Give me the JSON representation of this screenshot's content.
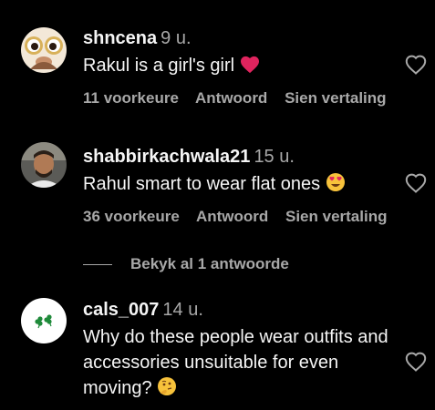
{
  "colors": {
    "background": "#000000",
    "primary_text": "#f5f5f5",
    "secondary_text": "#a8a8a8",
    "emoji_heart": "#e0245e",
    "emoji_yellow": "#f7c23b"
  },
  "comments": [
    {
      "username": "shncena",
      "time": "9 u.",
      "text": "Rakul is a girl's girl",
      "emoji": "red-heart-emoji",
      "likes": "11 voorkeure",
      "reply_label": "Antwoord",
      "translate_label": "Sien vertaling"
    },
    {
      "username": "shabbirkachwala21",
      "time": "15 u.",
      "text": "Rahul smart to wear flat ones",
      "emoji": "heart-eyes-emoji",
      "likes": "36 voorkeure",
      "reply_label": "Antwoord",
      "translate_label": "Sien vertaling"
    },
    {
      "username": "cals_007",
      "time": "14 u.",
      "text": "Why do these people wear outfits and accessories unsuitable for even moving?",
      "emoji": "thinking-face-emoji"
    }
  ],
  "view_replies_label": "Bekyk al 1 antwoorde",
  "icons": {
    "like": "heart-outline-icon"
  }
}
